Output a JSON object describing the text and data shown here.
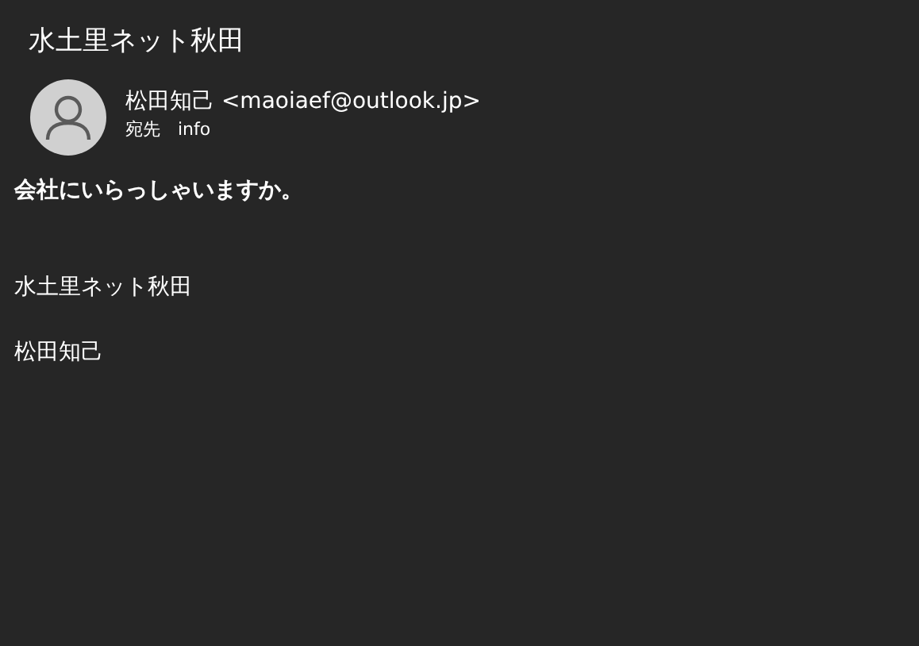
{
  "subject": "水土里ネット秋田",
  "sender": {
    "name": "松田知己 <maoiaef@outlook.jp>"
  },
  "recipient": {
    "label": "宛先",
    "value": "info"
  },
  "body": [
    {
      "kind": "bold",
      "text": "会社にいらっしゃいますか。"
    },
    {
      "kind": "gap"
    },
    {
      "kind": "plain",
      "text": "水土里ネット秋田"
    },
    {
      "kind": "plain",
      "text": "松田知己"
    }
  ]
}
